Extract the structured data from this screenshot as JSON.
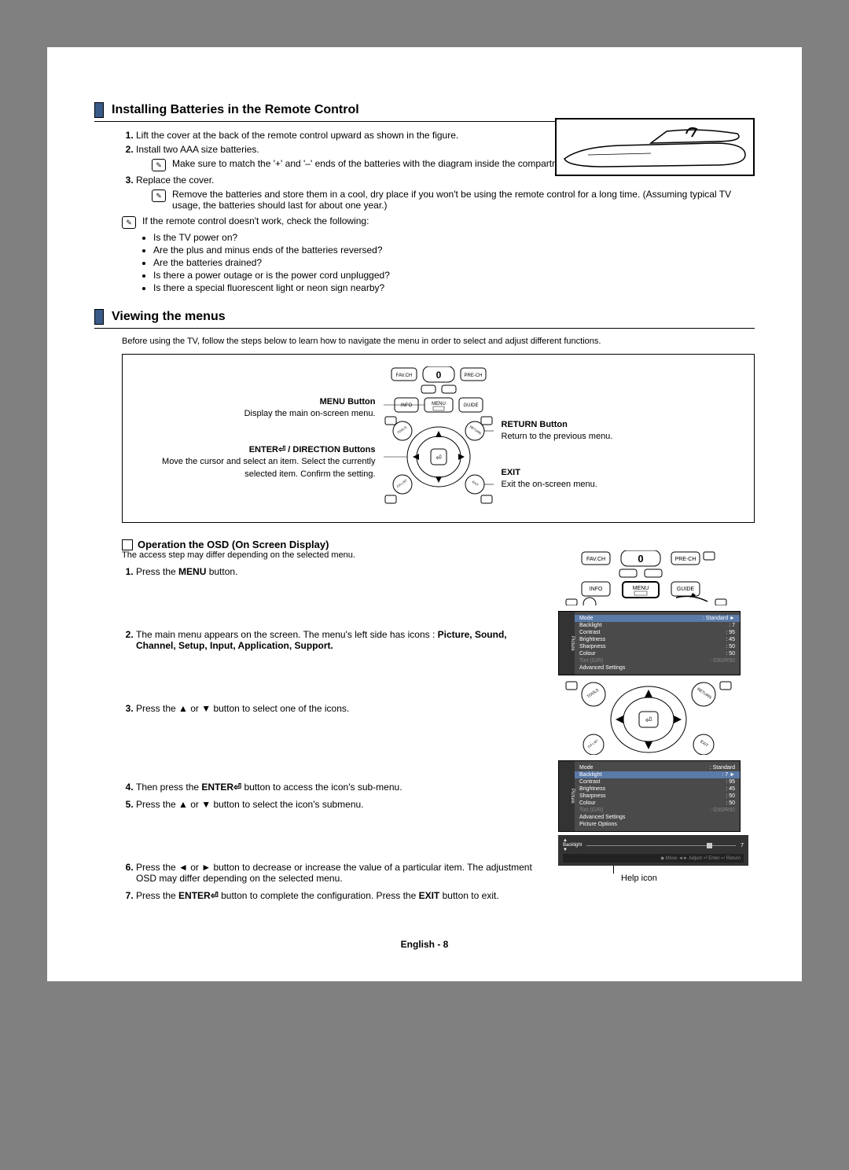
{
  "section1": {
    "title": "Installing Batteries in the Remote Control",
    "step1": "Lift the cover at the back of the remote control upward as shown in the figure.",
    "step2": "Install two AAA size batteries.",
    "note2": "Make sure to match the '+' and '–' ends of the batteries with the diagram inside the compartment.",
    "step3": "Replace the cover.",
    "note3": "Remove the batteries and store them in a cool, dry place if you won't be using the remote control for a long time. (Assuming typical TV usage, the batteries should last for about one year.)",
    "noteIntro": "If the remote control doesn't work, check the following:",
    "bullets": [
      "Is the TV power on?",
      "Are the plus and minus ends of the batteries reversed?",
      "Are the batteries drained?",
      "Is there a power outage or is the power cord unplugged?",
      "Is there a special fluorescent light or neon sign nearby?"
    ]
  },
  "section2": {
    "title": "Viewing the menus",
    "intro": "Before using the TV, follow the steps below to learn how to navigate the menu in order to select and adjust different functions.",
    "diagram": {
      "menuBtnTitle": "MENU Button",
      "menuBtnDesc": "Display the main on-screen menu.",
      "enterBtnTitle": "ENTER⏎ / DIRECTION Buttons",
      "enterBtnDesc": "Move the cursor and select an item. Select the currently selected item. Confirm the setting.",
      "returnBtnTitle": "RETURN Button",
      "returnBtnDesc": "Return to the previous menu.",
      "exitBtnTitle": "EXIT",
      "exitBtnDesc": "Exit the on-screen menu."
    },
    "buttons": {
      "favch": "FAV.CH",
      "prech": "PRE-CH",
      "info": "INFO",
      "menu": "MENU",
      "guide": "GUIDE"
    }
  },
  "osd": {
    "title": "Operation the OSD (On Screen Display)",
    "intro": "The access step may differ depending on the selected menu.",
    "step1a": "Press the ",
    "step1b": "MENU",
    "step1c": " button.",
    "step2a": "The main menu appears on the screen. The menu's left side has icons : ",
    "step2b": "Picture, Sound, Channel, Setup, Input, Application, Support.",
    "step3": "Press the ▲ or ▼ button to select one of the icons.",
    "step4a": "Then press the ",
    "step4b": "ENTER⏎",
    "step4c": " button to access the icon's sub-menu.",
    "step5": "Press the ▲ or ▼ button to select the icon's submenu.",
    "step6": "Press the ◄ or ► button to decrease or increase the value of a particular item. The adjustment OSD may differ depending on the selected menu.",
    "step7a": "Press the ",
    "step7b": "ENTER⏎",
    "step7c": " button to complete the configuration. Press the ",
    "step7d": "EXIT",
    "step7e": " button to exit."
  },
  "osdScreen1": {
    "sidebar": "Picture",
    "rows": [
      {
        "k": "Mode",
        "v": ": Standard",
        "hl": true,
        "arrow": "►"
      },
      {
        "k": "Backlight",
        "v": ": 7"
      },
      {
        "k": "Contrast",
        "v": ": 95"
      },
      {
        "k": "Brightness",
        "v": ": 45"
      },
      {
        "k": "Sharpness",
        "v": ": 50"
      },
      {
        "k": "Colour",
        "v": ": 50"
      },
      {
        "k": "Tint (G/R)",
        "v": ": G50/R50",
        "dim": true
      },
      {
        "k": "Advanced Settings",
        "v": ""
      }
    ]
  },
  "osdScreen2": {
    "sidebar": "Picture",
    "rows": [
      {
        "k": "Mode",
        "v": ": Standard"
      },
      {
        "k": "Backlight",
        "v": ": 7",
        "hl": true,
        "arrow": "►"
      },
      {
        "k": "Contrast",
        "v": ": 95"
      },
      {
        "k": "Brightness",
        "v": ": 45"
      },
      {
        "k": "Sharpness",
        "v": ": 50"
      },
      {
        "k": "Colour",
        "v": ": 50"
      },
      {
        "k": "Tint (G/R)",
        "v": ": G50/R50",
        "dim": true
      },
      {
        "k": "Advanced Settings",
        "v": ""
      },
      {
        "k": "Picture Options",
        "v": ""
      }
    ]
  },
  "slider": {
    "label": "Backlight",
    "value": "7",
    "help": "◆ Move    ◄► Adjust    ⏎ Enter    ↩ Return"
  },
  "helpIcon": "Help icon",
  "footer": "English - 8"
}
